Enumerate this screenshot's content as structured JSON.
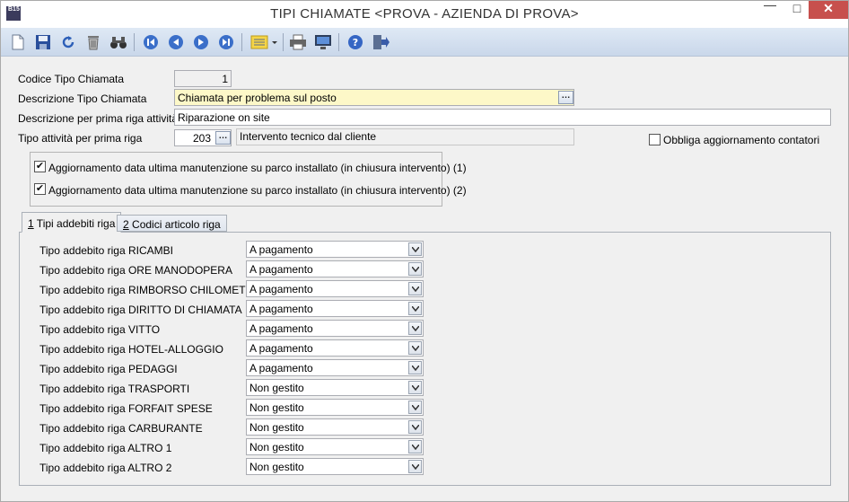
{
  "window": {
    "title": "TIPI CHIAMATE <PROVA - AZIENDA DI PROVA>",
    "app_badge": "B15",
    "min": "—",
    "max": "□",
    "close": "✕"
  },
  "toolbar": {
    "items": [
      "new-document-icon",
      "save-icon",
      "undo-icon",
      "delete-trash-icon",
      "find-binoculars-icon",
      "first-record-icon",
      "previous-record-icon",
      "next-record-icon",
      "last-record-icon",
      "list-options-icon",
      "print-icon",
      "preview-monitor-icon",
      "help-icon",
      "exit-icon"
    ]
  },
  "form": {
    "codice_label": "Codice Tipo Chiamata",
    "codice_value": "1",
    "descrizione_label": "Descrizione Tipo Chiamata",
    "descrizione_value": "Chiamata per problema sul posto",
    "prima_riga_label": "Descrizione per prima riga attività",
    "prima_riga_value": "Riparazione on site",
    "tipo_attivita_label": "Tipo attività per prima riga",
    "tipo_attivita_code": "203",
    "tipo_attivita_desc": "Intervento tecnico dal cliente",
    "dots": "…",
    "obbliga_label": "Obbliga aggiornamento contatori",
    "obbliga_checked": false,
    "aggiornamento": [
      {
        "label": "Aggiornamento data ultima manutenzione su parco installato (in chiusura intervento)  (1)",
        "checked": true
      },
      {
        "label": "Aggiornamento data ultima manutenzione su parco installato (in chiusura intervento)  (2)",
        "checked": true
      }
    ],
    "check_mark": "✔"
  },
  "tabs": [
    {
      "key": "1",
      "label": " Tipi addebiti riga"
    },
    {
      "key": "2",
      "label": " Codici articolo riga"
    }
  ],
  "addebiti": [
    {
      "label": "Tipo addebito riga RICAMBI",
      "value": "A pagamento"
    },
    {
      "label": "Tipo addebito riga ORE MANODOPERA",
      "value": "A pagamento"
    },
    {
      "label": "Tipo addebito riga RIMBORSO CHILOMETRI",
      "value": "A pagamento"
    },
    {
      "label": "Tipo addebito riga DIRITTO DI CHIAMATA",
      "value": "A pagamento"
    },
    {
      "label": "Tipo addebito riga VITTO",
      "value": "A pagamento"
    },
    {
      "label": "Tipo addebito riga HOTEL-ALLOGGIO",
      "value": "A pagamento"
    },
    {
      "label": "Tipo addebito riga PEDAGGI",
      "value": "A pagamento"
    },
    {
      "label": "Tipo addebito riga TRASPORTI",
      "value": "Non gestito"
    },
    {
      "label": "Tipo addebito riga FORFAIT SPESE",
      "value": "Non gestito"
    },
    {
      "label": "Tipo addebito riga CARBURANTE",
      "value": "Non gestito"
    },
    {
      "label": "Tipo addebito riga ALTRO 1",
      "value": "Non gestito"
    },
    {
      "label": "Tipo addebito riga ALTRO 2",
      "value": "Non gestito"
    }
  ]
}
